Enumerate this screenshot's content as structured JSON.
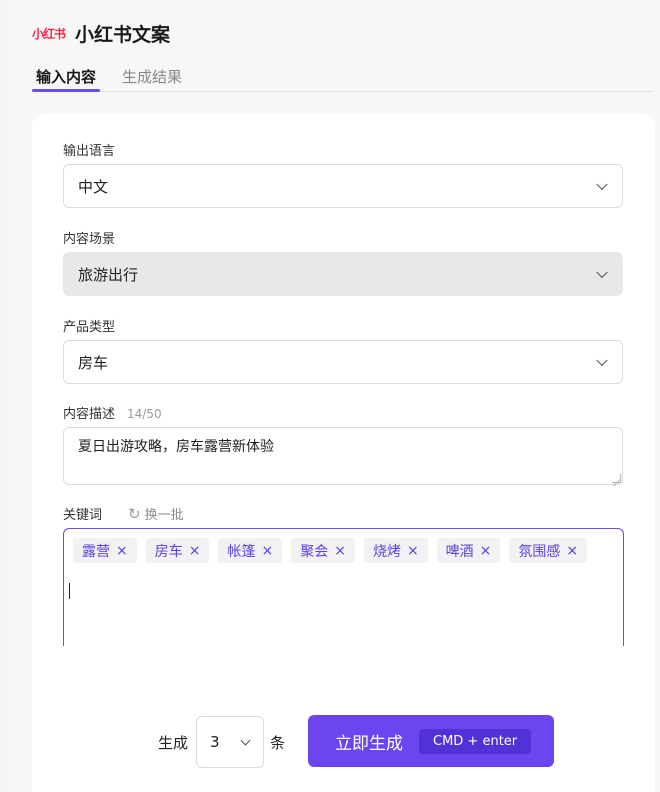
{
  "header": {
    "logo": "小红书",
    "title": "小红书文案"
  },
  "tabs": [
    {
      "label": "输入内容",
      "active": true
    },
    {
      "label": "生成结果",
      "active": false
    }
  ],
  "form": {
    "language": {
      "label": "输出语言",
      "value": "中文"
    },
    "scene": {
      "label": "内容场景",
      "value": "旅游出行"
    },
    "product": {
      "label": "产品类型",
      "value": "房车"
    },
    "description": {
      "label": "内容描述",
      "count": "14/50",
      "value": "夏日出游攻略，房车露营新体验"
    },
    "keywords": {
      "label": "关键词",
      "refresh_label": "换一批",
      "tags": [
        "露营",
        "房车",
        "帐篷",
        "聚会",
        "烧烤",
        "啤酒",
        "氛围感"
      ],
      "remove_glyph": "×"
    }
  },
  "footer": {
    "generate_prefix": "生成",
    "count_value": "3",
    "unit": "条",
    "generate_button": "立即生成",
    "shortcut": "CMD + enter"
  },
  "colors": {
    "accent": "#6a45f0",
    "brand": "#ff2442"
  }
}
